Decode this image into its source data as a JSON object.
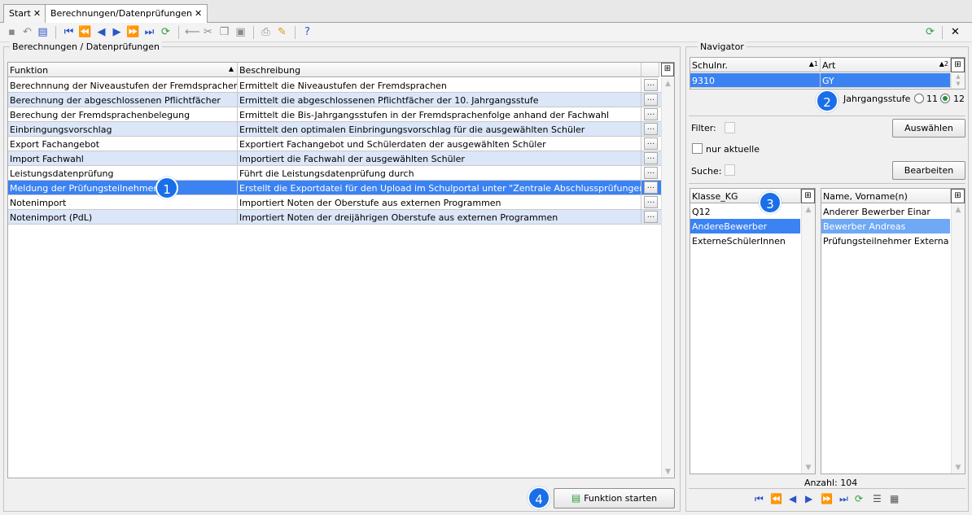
{
  "tabs": [
    {
      "label": "Start",
      "close": "✕"
    },
    {
      "label": "Berechnungen/Datenprüfungen",
      "close": "✕"
    }
  ],
  "main": {
    "group_title": "Berechnungen / Datenprüfungen",
    "columns": [
      "Funktion",
      "Beschreibung"
    ],
    "rows": [
      {
        "funktion": "Berechnnung der Niveaustufen der Fremdsprachen",
        "beschreibung": "Ermittelt die Niveaustufen der Fremdsprachen"
      },
      {
        "funktion": "Berechnung der abgeschlossenen Pflichtfächer",
        "beschreibung": "Ermittelt die abgeschlossenen Pflichtfächer der 10. Jahrgangsstufe"
      },
      {
        "funktion": "Berechung der Fremdsprachenbelegung",
        "beschreibung": "Ermittelt die Bis-Jahrgangsstufen in der Fremdsprachenfolge anhand der Fachwahl"
      },
      {
        "funktion": "Einbringungsvorschlag",
        "beschreibung": "Ermittelt den optimalen Einbringungsvorschlag für die ausgewählten Schüler"
      },
      {
        "funktion": "Export Fachangebot",
        "beschreibung": "Exportiert Fachangebot und Schülerdaten der ausgewählten Schüler"
      },
      {
        "funktion": "Import Fachwahl",
        "beschreibung": "Importiert die Fachwahl der ausgewählten Schüler"
      },
      {
        "funktion": "Leistungsdatenprüfung",
        "beschreibung": "Führt die Leistungsdatenprüfung durch"
      },
      {
        "funktion": "Meldung der Prüfungsteilnehmer",
        "beschreibung": "Erstellt die Exportdatei für den Upload im Schulportal unter \"Zentrale Abschlussprüfungen\""
      },
      {
        "funktion": "Notenimport",
        "beschreibung": "Importiert Noten der Oberstufe aus externen Programmen"
      },
      {
        "funktion": "Notenimport (PdL)",
        "beschreibung": "Importiert Noten der dreijährigen Oberstufe aus externen Programmen"
      }
    ],
    "dots_label": "...",
    "start_button": "Funktion starten"
  },
  "navigator": {
    "title": "Navigator",
    "school_columns": [
      "Schulnr.",
      "Art"
    ],
    "school_sort": [
      "1",
      "2"
    ],
    "school_row": {
      "nr": "9310",
      "art": "GY"
    },
    "jahrgang_label": "Jahrgangsstufe",
    "jahrgang_options": [
      "11",
      "12"
    ],
    "filter_label": "Filter:",
    "select_button": "Auswählen",
    "nur_aktuelle": "nur aktuelle",
    "suche_label": "Suche:",
    "edit_button": "Bearbeiten",
    "klasse_header": "Klasse_KG",
    "klassen": [
      "Q12",
      "AndereBewerber",
      "ExterneSchülerInnen"
    ],
    "name_header": "Name, Vorname(n)",
    "names": [
      "Anderer Bewerber Einar",
      "Bewerber Andreas",
      "Prüfungsteilnehmer Externa"
    ],
    "count": "Anzahl: 104"
  },
  "callouts": [
    "1",
    "2",
    "3",
    "4"
  ],
  "colors": {
    "selection": "#3b82f2",
    "alt_row": "#dbe6f8",
    "callout": "#1a6fe8"
  }
}
